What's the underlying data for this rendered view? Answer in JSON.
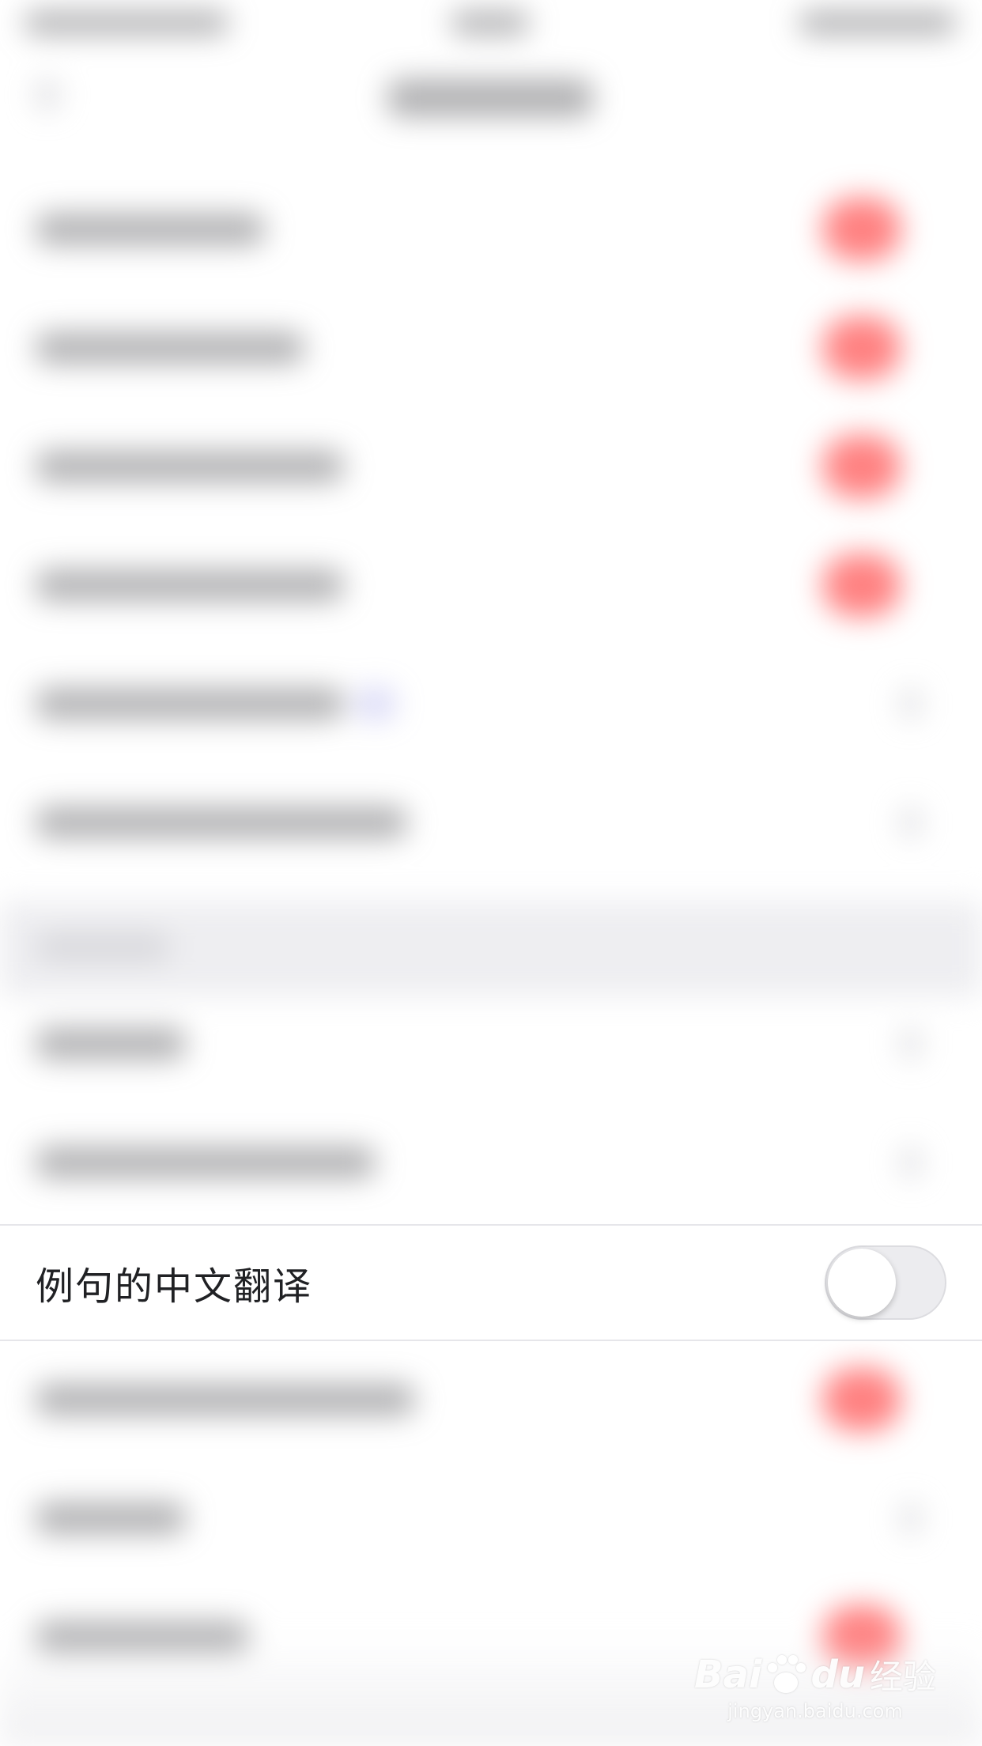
{
  "setting": {
    "label": "例句的中文翻译",
    "toggle_on": false
  },
  "watermark": {
    "brand_left": "Bai",
    "brand_right": "du",
    "suffix": "经验",
    "url": "jingyan.baidu.com"
  }
}
